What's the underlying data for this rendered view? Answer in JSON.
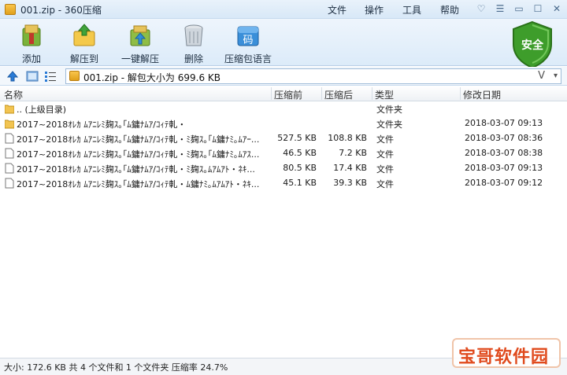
{
  "window": {
    "title": "001.zip - 360压缩",
    "menu": [
      "文件",
      "操作",
      "工具",
      "帮助"
    ],
    "controls": {
      "skin": "♡",
      "menu": "☰",
      "minimize": "▭",
      "maximize": "☐",
      "close": "✕"
    }
  },
  "toolbar": {
    "items": [
      {
        "label": "添加",
        "icon": "add-icon"
      },
      {
        "label": "解压到",
        "icon": "extract-to-icon"
      },
      {
        "label": "一键解压",
        "icon": "one-click-extract-icon"
      },
      {
        "label": "删除",
        "icon": "trash-icon"
      },
      {
        "label": "压缩包语言",
        "icon": "archive-language-icon"
      }
    ],
    "security_label": "安全",
    "language_glyph": "码"
  },
  "address": {
    "path": "001.zip - 解包大小为 699.6 KB",
    "v_label": "V",
    "dropdown": "▾"
  },
  "columns": {
    "name": "名称",
    "packed": "压缩前",
    "size": "压缩后",
    "type": "类型",
    "date": "修改日期"
  },
  "files": [
    {
      "name": ".. (上级目录)",
      "packed": "",
      "size": "",
      "type": "文件夹",
      "date": "",
      "kind": "folder"
    },
    {
      "name": "2017~2018ｵﾚｶ ﾑｱﾆﾚﾐ麹ｽ｡｢ﾑ鏞ﾅﾑｱ/ｺｨﾃ軋・",
      "packed": "",
      "size": "",
      "type": "文件夹",
      "date": "2018-03-07 09:13",
      "kind": "folder"
    },
    {
      "name": "2017~2018ｵﾚｶ ﾑｱﾆﾚﾐ麹ｽ｡｢ﾑ鏞ﾅﾑｱ/ｺｨﾃ軋・ﾐ麹ｽ｡｢ﾑ鏞ﾅﾐ｡ﾑｱｰ...",
      "packed": "527.5 KB",
      "size": "108.8 KB",
      "type": "文件",
      "date": "2018-03-07 08:36",
      "kind": "file"
    },
    {
      "name": "2017~2018ｵﾚｶ ﾑｱﾆﾚﾐ麹ｽ｡｢ﾑ鏞ﾅﾑｱ/ｺｨﾃ軋・ﾐ麹ｽ｡｢ﾑ鏞ﾅﾐ｡ﾑｱｽ...",
      "packed": "46.5 KB",
      "size": "7.2 KB",
      "type": "文件",
      "date": "2018-03-07 08:38",
      "kind": "file"
    },
    {
      "name": "2017~2018ｵﾚｶ ﾑｱﾆﾚﾐ麹ｽ｡｢ﾑ鏞ﾅﾑｱ/ｺｨﾃ軋・ﾐ麹ｽ｡ﾑｱﾑｱﾄ・ﾈｷ...",
      "packed": "80.5 KB",
      "size": "17.4 KB",
      "type": "文件",
      "date": "2018-03-07 09:13",
      "kind": "file"
    },
    {
      "name": "2017~2018ｵﾚｶ ﾑｱﾆﾚﾐ麹ｽ｡｢ﾑ鏞ﾅﾑｱ/ｺｨﾃ軋・ﾑ鏞ﾅﾐ｡ﾑｱﾑｱﾄ・ﾈｷ...",
      "packed": "45.1 KB",
      "size": "39.3 KB",
      "type": "文件",
      "date": "2018-03-07 09:12",
      "kind": "file"
    }
  ],
  "status": "大小: 172.6 KB 共 4 个文件和 1 个文件夹 压缩率 24.7%",
  "watermark": "宝哥软件园",
  "colors": {
    "accent": "#2a7bd6",
    "shield": "#3e9d2b",
    "watermark": "#e04b1e"
  }
}
